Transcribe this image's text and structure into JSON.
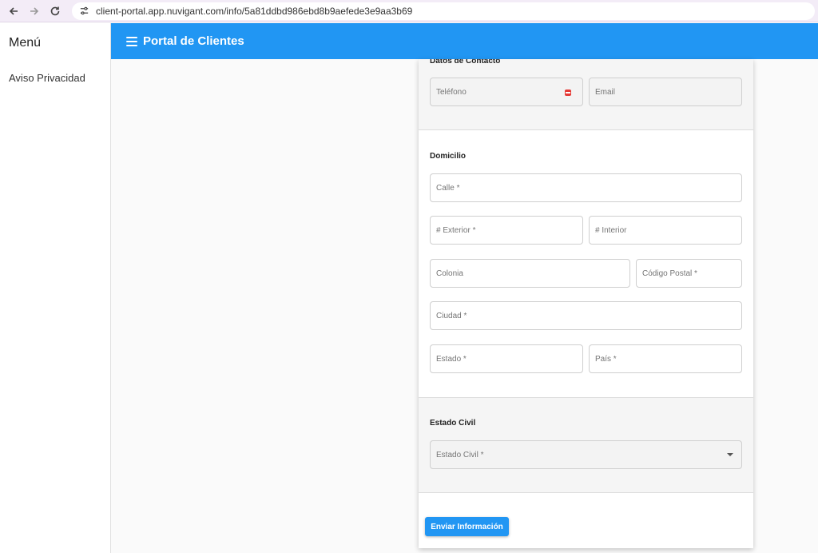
{
  "browser": {
    "url": "client-portal.app.nuvigant.com/info/5a81ddbd986ebd8b9aefede3e9aa3b69"
  },
  "sidebar": {
    "title": "Menú",
    "items": [
      {
        "label": "Aviso Privacidad"
      }
    ]
  },
  "app_bar": {
    "title": "Portal de Clientes"
  },
  "form": {
    "contacto": {
      "title": "Datos de Contacto",
      "telefono_label": "Teléfono",
      "email_label": "Email"
    },
    "domicilio": {
      "title": "Domicilio",
      "calle_label": "Calle *",
      "exterior_label": "# Exterior *",
      "interior_label": "# Interior",
      "colonia_label": "Colonia",
      "codigo_postal_label": "Código Postal *",
      "ciudad_label": "Ciudad *",
      "estado_label": "Estado *",
      "pais_label": "País *"
    },
    "estado_civil": {
      "title": "Estado Civil",
      "select_label": "Estado Civil *"
    },
    "submit_label": "Enviar Información"
  },
  "colors": {
    "primary": "#2196f3",
    "error": "#e53935",
    "browser_bar": "#f3ecf7"
  },
  "icons": {
    "back": "arrow-left-icon",
    "forward": "arrow-right-icon",
    "reload": "reload-icon",
    "site_info": "tune-icon",
    "menu": "hamburger-menu-icon",
    "error": "error-icon",
    "dropdown": "caret-down-icon"
  }
}
